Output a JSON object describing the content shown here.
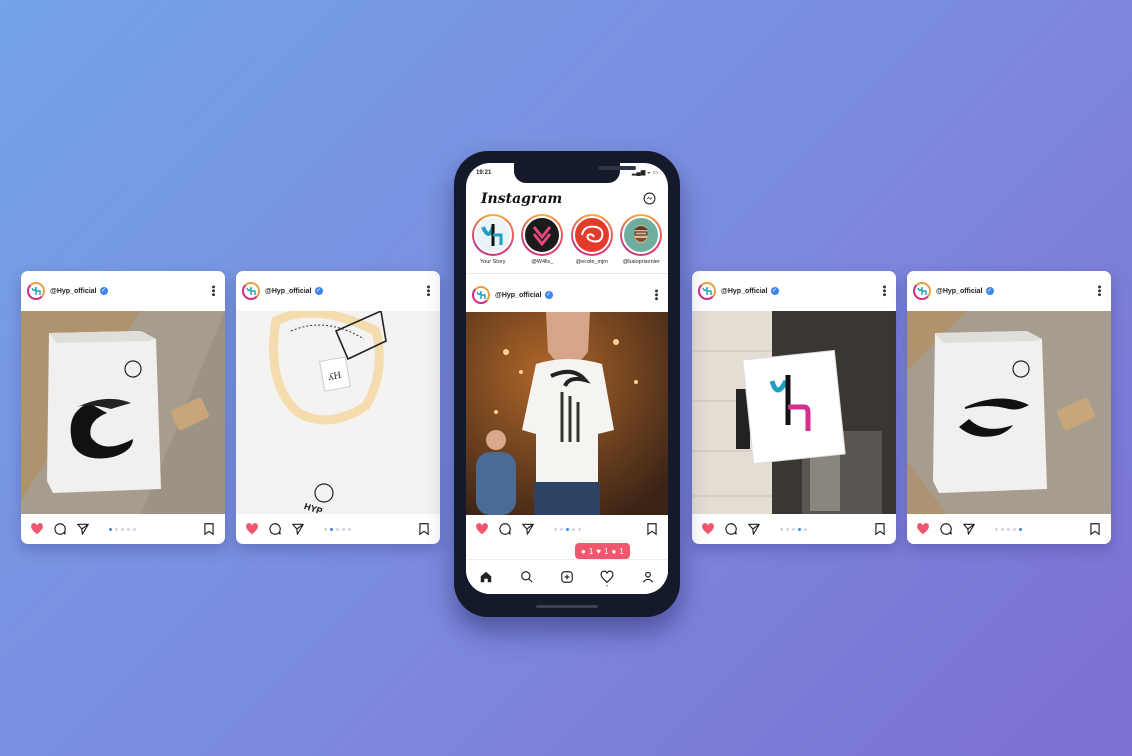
{
  "colors": {
    "accent": "#f0566d",
    "verified": "#3d85e8",
    "story_ring": "#e43d6a"
  },
  "cards": [
    {
      "username": "@Hyp_official",
      "photo": "folded-tshirt-with-brush-logo"
    },
    {
      "username": "@Hyp_official",
      "photo": "tshirt-collar-label-hyp"
    },
    {
      "username": "@Hyp_official",
      "photo": "shop-sign-logo"
    },
    {
      "username": "@Hyp_official",
      "photo": "folded-tshirt-with-logo"
    }
  ],
  "phone": {
    "status_time": "19:21",
    "app_title": "Instagram",
    "stories": [
      {
        "label": "Your Story"
      },
      {
        "label": "@W4lls_"
      },
      {
        "label": "@ecole_mjm"
      },
      {
        "label": "@baloprisonier"
      }
    ],
    "post": {
      "username": "@Hyp_official",
      "photo": "woman-in-graphic-tshirt"
    },
    "notification": {
      "comments": "1",
      "likes": "1",
      "follows": "1"
    },
    "tabs": [
      "home-icon",
      "search-icon",
      "add-post-icon",
      "heart-icon",
      "profile-icon"
    ]
  }
}
